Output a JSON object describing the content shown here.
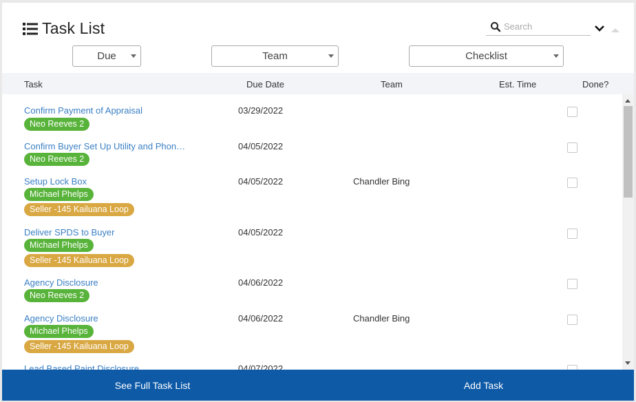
{
  "header": {
    "title": "Task List",
    "title_icon": "list-icon",
    "search_placeholder": "Search"
  },
  "filters": {
    "due": "Due",
    "team": "Team",
    "checklist": "Checklist"
  },
  "columns": {
    "task": "Task",
    "due_date": "Due Date",
    "team": "Team",
    "est_time": "Est. Time",
    "done": "Done?"
  },
  "tasks": [
    {
      "name": "Confirm Payment of Appraisal",
      "due": "03/29/2022",
      "team": "",
      "tags": [
        {
          "label": "Neo Reeves 2",
          "color": "green"
        }
      ]
    },
    {
      "name": "Confirm Buyer Set Up Utility and Phon…",
      "due": "04/05/2022",
      "team": "",
      "tags": [
        {
          "label": "Neo Reeves 2",
          "color": "green"
        }
      ]
    },
    {
      "name": "Setup Lock Box",
      "due": "04/05/2022",
      "team": "Chandler Bing",
      "tags": [
        {
          "label": "Michael Phelps",
          "color": "green"
        },
        {
          "label": "Seller -145 Kailuana Loop",
          "color": "orange"
        }
      ]
    },
    {
      "name": "Deliver SPDS to Buyer",
      "due": "04/05/2022",
      "team": "",
      "tags": [
        {
          "label": "Michael Phelps",
          "color": "green"
        },
        {
          "label": "Seller -145 Kailuana Loop",
          "color": "orange"
        }
      ]
    },
    {
      "name": "Agency Disclosure",
      "due": "04/06/2022",
      "team": "",
      "tags": [
        {
          "label": "Neo Reeves 2",
          "color": "green"
        }
      ]
    },
    {
      "name": "Agency Disclosure",
      "due": "04/06/2022",
      "team": "Chandler Bing",
      "tags": [
        {
          "label": "Michael Phelps",
          "color": "green"
        },
        {
          "label": "Seller -145 Kailuana Loop",
          "color": "orange"
        }
      ]
    },
    {
      "name": "Lead Based Paint Disclosure",
      "due": "04/07/2022",
      "team": "",
      "tags": []
    }
  ],
  "footer": {
    "full_list": "See Full Task List",
    "add_task": "Add Task"
  },
  "colors": {
    "link": "#3a7fc4",
    "tag_green": "#58b33a",
    "tag_orange": "#d9a843",
    "footer": "#0e5aa7"
  }
}
